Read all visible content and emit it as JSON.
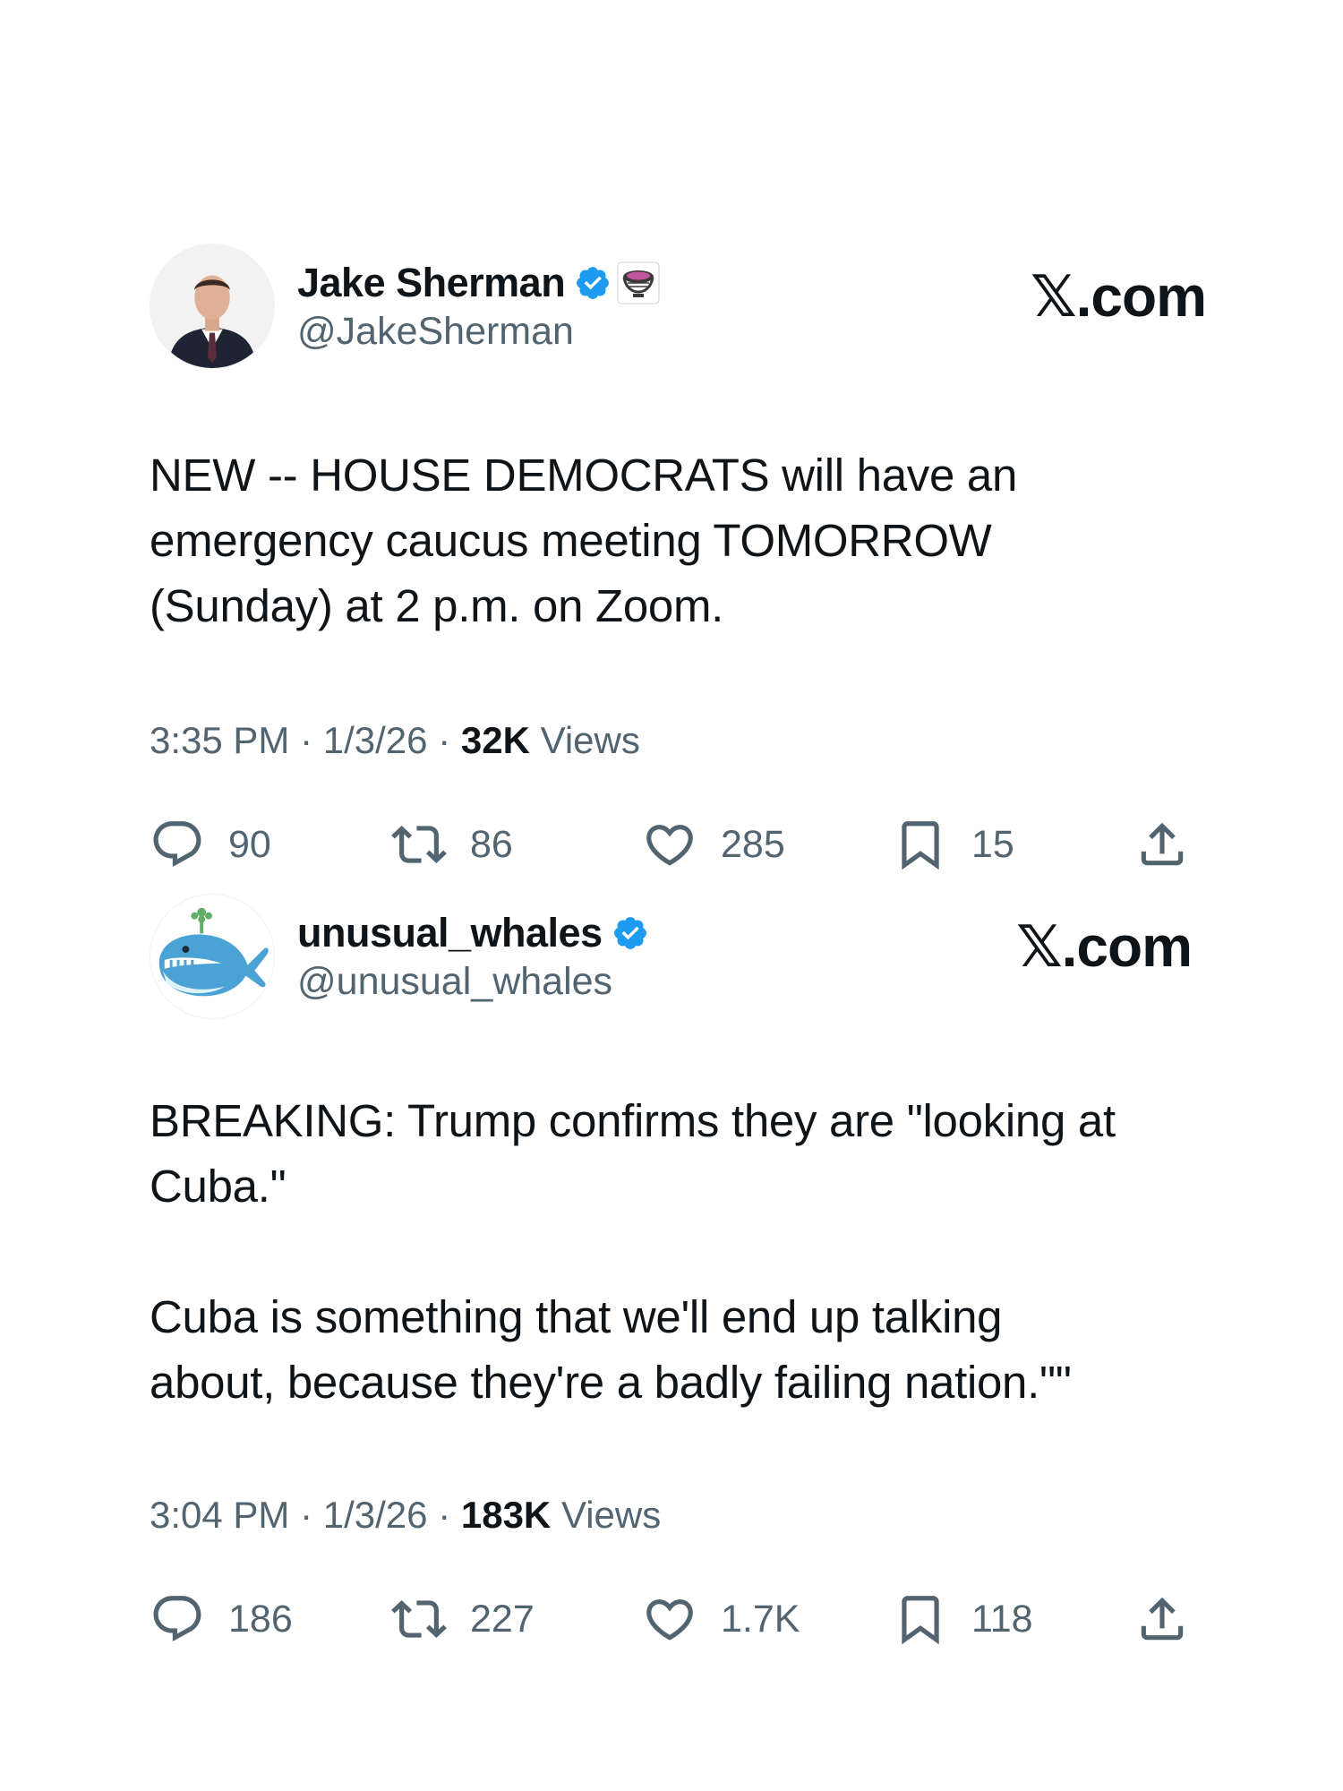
{
  "tweets": [
    {
      "author": {
        "name": "Jake Sherman",
        "handle": "@JakeSherman",
        "verified": true,
        "affiliate_badge": "punchbowl-logo"
      },
      "brand": "𝕏.com",
      "text": "NEW -- HOUSE DEMOCRATS will have an\nemergency caucus meeting TOMORROW\n(Sunday) at 2 p.m. on Zoom.",
      "time": "3:35 PM",
      "date": "1/3/26",
      "views_count": "32K",
      "views_label": "Views",
      "stats": {
        "replies": "90",
        "retweets": "86",
        "likes": "285",
        "bookmarks": "15"
      }
    },
    {
      "author": {
        "name": "unusual_whales",
        "handle": "@unusual_whales",
        "verified": true
      },
      "brand": "𝕏.com",
      "text": "BREAKING: Trump confirms they are \"looking at\nCuba.\"\n\nCuba is something that we'll end up talking\nabout, because they're a badly failing nation.\"\"",
      "time": "3:04 PM",
      "date": "1/3/26",
      "views_count": "183K",
      "views_label": "Views",
      "stats": {
        "replies": "186",
        "retweets": "227",
        "likes": "1.7K",
        "bookmarks": "118"
      }
    }
  ],
  "colors": {
    "text": "#0f1419",
    "secondary": "#536471",
    "verified_blue": "#1d9bf0"
  },
  "icons": [
    "reply-icon",
    "retweet-icon",
    "like-icon",
    "bookmark-icon",
    "share-icon",
    "verified-badge-icon"
  ]
}
